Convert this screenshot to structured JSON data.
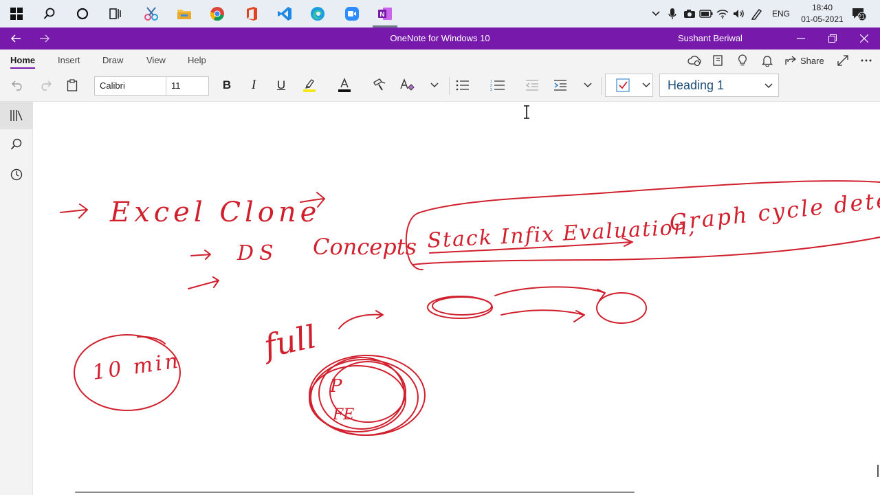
{
  "taskbar": {
    "icons": [
      "windows-start-icon",
      "search-icon",
      "cortana-icon",
      "task-view-icon",
      "snipping-tool-icon",
      "file-explorer-icon",
      "chrome-icon",
      "office-icon",
      "vscode-icon",
      "edge-icon",
      "zoom-icon",
      "onenote-icon"
    ],
    "language": "ENG",
    "time": "18:40",
    "date": "01-05-2021",
    "notification_count": "21"
  },
  "window": {
    "title": "OneNote for Windows 10",
    "user": "Sushant Beriwal"
  },
  "ribbon": {
    "tabs": [
      "Home",
      "Insert",
      "Draw",
      "View",
      "Help"
    ],
    "active_tab": "Home",
    "share_label": "Share",
    "font_name": "Calibri",
    "font_size": "11",
    "style": "Heading 1"
  },
  "page": {
    "ink_text": [
      "Excel Clone",
      "DS",
      "Concepts",
      "Stack Infix Evaluation,",
      "Graph cycle detection",
      "full",
      "10 min",
      "P",
      "FE"
    ]
  },
  "colors": {
    "accent": "#7719aa",
    "ink": "#d0202e",
    "taskbar": "#e8eef4"
  }
}
